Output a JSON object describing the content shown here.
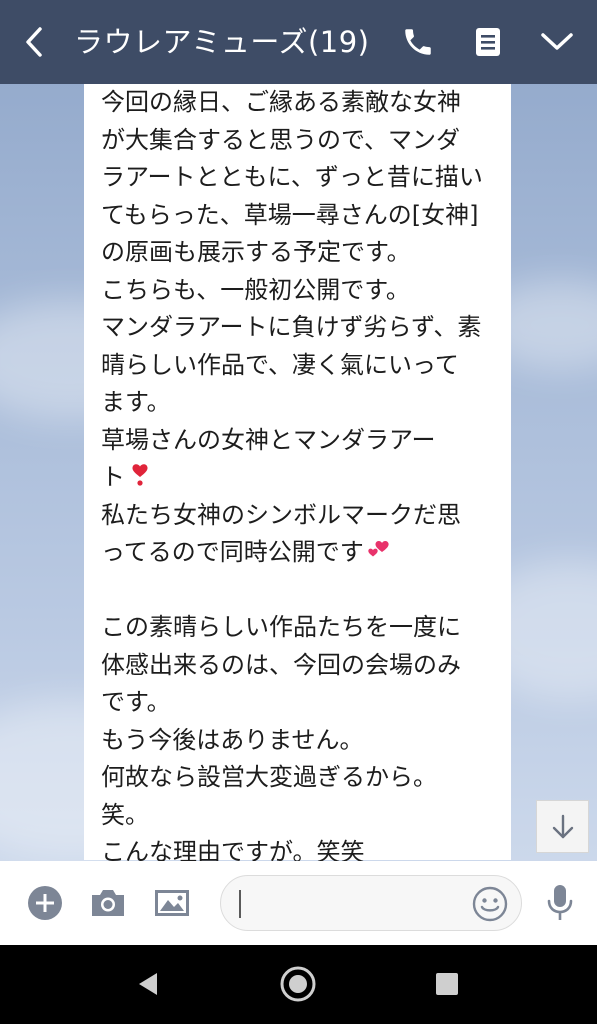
{
  "header": {
    "title": "ラウレアミューズ(19)",
    "background": "#3e4c66"
  },
  "message": {
    "lines": [
      "今回の縁日、ご縁ある素敵な女神",
      "が大集合すると思うので、マンダ",
      "ラアートとともに、ずっと昔に描い",
      "てもらった、草場一尋さんの[女神]",
      "の原画も展示する予定です。",
      "こちらも、一般初公開です。",
      "マンダラアートに負けず劣らず、素",
      "晴らしい作品で、凄く氣にいって",
      "ます。",
      "草場さんの女神とマンダラアー",
      "ト",
      "私たち女神のシンボルマークだ思",
      "ってるので同時公開です",
      "",
      "この素晴らしい作品たちを一度に",
      "体感出来るのは、今回の会場のみ",
      "です。",
      "もう今後はありません。",
      "何故なら設営大変過ぎるから。",
      "笑。",
      "こんな理由ですが。笑笑"
    ],
    "emoji": {
      "line_11": "heart-exclamation-icon",
      "line_13": "two-hearts-icon"
    }
  },
  "input": {
    "placeholder": ""
  },
  "icons": {
    "back": "chevron-left-icon",
    "call": "phone-icon",
    "notes": "notes-icon",
    "menu": "chevron-down-icon",
    "scroll": "arrow-down-icon",
    "add": "plus-circle-icon",
    "camera": "camera-icon",
    "image": "image-icon",
    "emoji": "smiley-icon",
    "mic": "microphone-icon",
    "nav_back": "triangle-back-icon",
    "nav_home": "circle-home-icon",
    "nav_recent": "square-recent-icon"
  },
  "colors": {
    "accent_heart": "#e0243a",
    "two_hearts": "#e8336b"
  }
}
